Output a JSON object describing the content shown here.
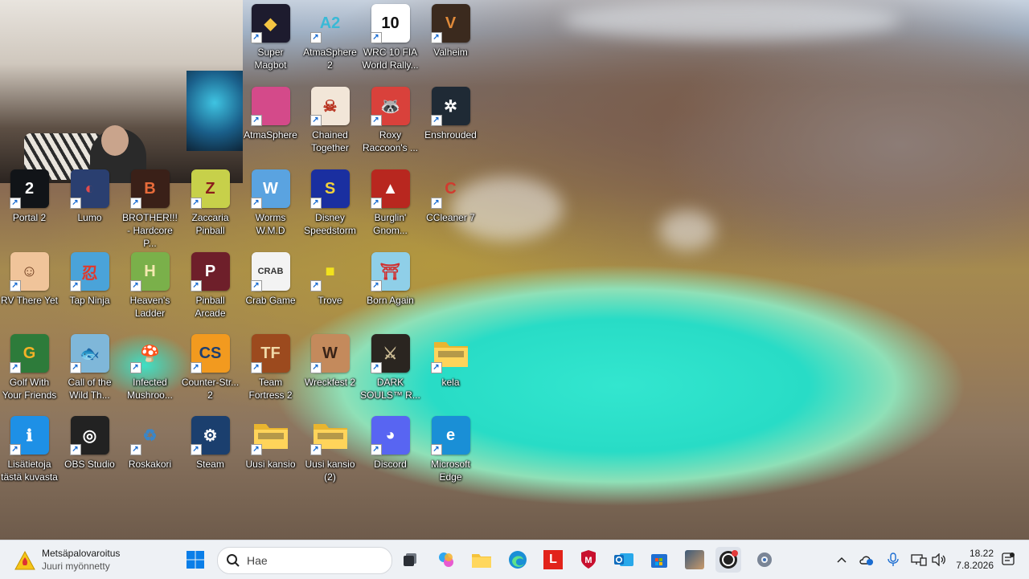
{
  "desktop": {
    "icons": [
      {
        "id": "super-magbot",
        "label": "Super Magbot",
        "bg": "#1d1b2e",
        "glyph": "◆",
        "fg": "#f5c542"
      },
      {
        "id": "atmasphere-2",
        "label": "AtmaSphere 2",
        "bg": "transparent",
        "glyph": "A2",
        "fg": "#39b9d6"
      },
      {
        "id": "wrc-10",
        "label": "WRC 10 FIA World Rally...",
        "bg": "#ffffff",
        "glyph": "10",
        "fg": "#111111"
      },
      {
        "id": "valheim",
        "label": "Valheim",
        "bg": "#3b2a1e",
        "glyph": "V",
        "fg": "#e08a3a"
      },
      {
        "id": "atmasphere",
        "label": "AtmaSphere",
        "bg": "#d44a8a",
        "glyph": "",
        "fg": "#ffffff"
      },
      {
        "id": "chained-together",
        "label": "Chained Together",
        "bg": "#f2e6d8",
        "glyph": "☠",
        "fg": "#b8321f"
      },
      {
        "id": "roxy-raccoon",
        "label": "Roxy Raccoon's ...",
        "bg": "#d9413b",
        "glyph": "🦝",
        "fg": "#ffffff"
      },
      {
        "id": "enshrouded",
        "label": "Enshrouded",
        "bg": "#1f2a35",
        "glyph": "✲",
        "fg": "#ffffff"
      },
      {
        "id": "portal-2",
        "label": "Portal 2",
        "bg": "#111418",
        "glyph": "2",
        "fg": "#ffffff"
      },
      {
        "id": "lumo",
        "label": "Lumo",
        "bg": "#2a3f70",
        "glyph": "◐",
        "fg": "#e24b4b"
      },
      {
        "id": "brother",
        "label": "BROTHER!!! - Hardcore P...",
        "bg": "#3a2018",
        "glyph": "B",
        "fg": "#e86b3a"
      },
      {
        "id": "zaccaria-pinball",
        "label": "Zaccaria Pinball",
        "bg": "#c7d04a",
        "glyph": "Z",
        "fg": "#8b1c1c"
      },
      {
        "id": "worms",
        "label": "Worms W.M.D",
        "bg": "#5aa3e0",
        "glyph": "W",
        "fg": "#ffffff"
      },
      {
        "id": "disney-speedstorm",
        "label": "Disney Speedstorm",
        "bg": "#1a2fa0",
        "glyph": "S",
        "fg": "#f2d13b"
      },
      {
        "id": "burglin-gnomes",
        "label": "Burglin' Gnom...",
        "bg": "#b8271f",
        "glyph": "▲",
        "fg": "#ffffff"
      },
      {
        "id": "ccleaner",
        "label": "CCleaner 7",
        "bg": "transparent",
        "glyph": "C",
        "fg": "#d13b2f"
      },
      {
        "id": "rv-there-yet",
        "label": "RV There Yet",
        "bg": "#f0c49a",
        "glyph": "☺",
        "fg": "#6b3a1c"
      },
      {
        "id": "tap-ninja",
        "label": "Tap Ninja",
        "bg": "#4aa3d9",
        "glyph": "忍",
        "fg": "#e2382b"
      },
      {
        "id": "heavens-ladder",
        "label": "Heaven's Ladder",
        "bg": "#7ab04a",
        "glyph": "H",
        "fg": "#f4e9b0"
      },
      {
        "id": "pinball-arcade",
        "label": "Pinball Arcade",
        "bg": "#6e1f2a",
        "glyph": "P",
        "fg": "#ffffff"
      },
      {
        "id": "crab-game",
        "label": "Crab Game",
        "bg": "#f3f3f3",
        "glyph": "CRAB",
        "fg": "#333333"
      },
      {
        "id": "trove",
        "label": "Trove",
        "bg": "transparent",
        "glyph": "■",
        "fg": "#f2e21c"
      },
      {
        "id": "born-again",
        "label": "Born Again",
        "bg": "#8fcfe8",
        "glyph": "⛩",
        "fg": "#d12f2f"
      },
      {
        "id": "golf-with-friends",
        "label": "Golf With Your Friends",
        "bg": "#2d7b3a",
        "glyph": "G",
        "fg": "#f4b227"
      },
      {
        "id": "call-of-the-wild",
        "label": "Call of the Wild Th...",
        "bg": "#7fb7d9",
        "glyph": "🐟",
        "fg": "#ffffff"
      },
      {
        "id": "infected-mushroom",
        "label": "Infected Mushroo...",
        "bg": "transparent",
        "glyph": "🍄",
        "fg": "#8b3a1f"
      },
      {
        "id": "counter-strike-2",
        "label": "Counter-Str... 2",
        "bg": "#f29a1f",
        "glyph": "CS",
        "fg": "#1d3e6e"
      },
      {
        "id": "team-fortress-2",
        "label": "Team Fortress 2",
        "bg": "#9c4a1e",
        "glyph": "TF",
        "fg": "#f0d9a8"
      },
      {
        "id": "wreckfest-2",
        "label": "Wreckfest 2",
        "bg": "#c48a5c",
        "glyph": "W",
        "fg": "#3a2418"
      },
      {
        "id": "dark-souls",
        "label": "DARK SOULS™ R...",
        "bg": "#2a2520",
        "glyph": "⚔",
        "fg": "#c8b891"
      },
      {
        "id": "kela",
        "label": "kela",
        "bg": "folder",
        "glyph": "",
        "fg": "#000000"
      },
      {
        "id": "lisatietoja",
        "label": "Lisätietoja tästä kuvasta",
        "bg": "#1e90e6",
        "glyph": "ℹ",
        "fg": "#ffffff"
      },
      {
        "id": "obs-studio",
        "label": "OBS Studio",
        "bg": "#222222",
        "glyph": "◎",
        "fg": "#ffffff"
      },
      {
        "id": "roskakori",
        "label": "Roskakori",
        "bg": "transparent",
        "glyph": "♻",
        "fg": "#3a86c8"
      },
      {
        "id": "steam",
        "label": "Steam",
        "bg": "#1b3f6e",
        "glyph": "⚙",
        "fg": "#ffffff"
      },
      {
        "id": "uusi-kansio",
        "label": "Uusi kansio",
        "bg": "folder",
        "glyph": "",
        "fg": "#000000"
      },
      {
        "id": "uusi-kansio-2",
        "label": "Uusi kansio (2)",
        "bg": "folder",
        "glyph": "",
        "fg": "#000000"
      },
      {
        "id": "discord",
        "label": "Discord",
        "bg": "#5865f2",
        "glyph": "◕",
        "fg": "#ffffff"
      },
      {
        "id": "microsoft-edge",
        "label": "Microsoft Edge",
        "bg": "#1a8fd6",
        "glyph": "e",
        "fg": "#ffffff"
      }
    ]
  },
  "taskbar": {
    "notification": {
      "title": "Metsäpalovaroitus",
      "subtitle": "Juuri myönnetty"
    },
    "search_placeholder": "Hae",
    "clock": {
      "time": "18.22",
      "date": "7.8.2026"
    },
    "shortcut_glyph": "↗"
  }
}
